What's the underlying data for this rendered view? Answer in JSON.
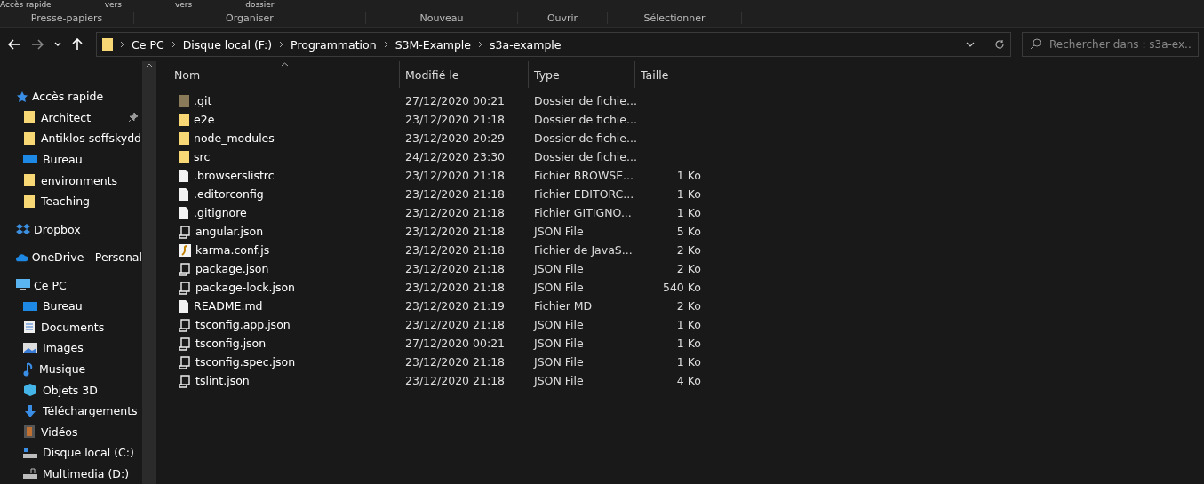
{
  "ribbon": {
    "cut_texts": [
      {
        "text": "Accès rapide"
      },
      {
        "text": "vers"
      },
      {
        "text": "vers"
      },
      {
        "text": "dossier"
      }
    ],
    "groups": [
      "Presse-papiers",
      "Organiser",
      "Nouveau",
      "Ouvrir",
      "Sélectionner"
    ]
  },
  "address_bar": {
    "path": [
      "Ce PC",
      "Disque local (F:)",
      "Programmation",
      "S3M-Example",
      "s3a-example"
    ]
  },
  "search": {
    "placeholder": "Rechercher dans : s3a-ex..."
  },
  "sidebar": {
    "sections": [
      {
        "label": "Accès rapide",
        "kind": "quick",
        "children": [
          {
            "label": "Architect",
            "kind": "folder",
            "pinned": true
          },
          {
            "label": "Antiklos soffskydd",
            "kind": "folder",
            "pinned": false
          },
          {
            "label": "Bureau",
            "kind": "desktop",
            "pinned": false
          },
          {
            "label": "environments",
            "kind": "folder",
            "pinned": false
          },
          {
            "label": "Teaching",
            "kind": "folder",
            "pinned": false
          }
        ]
      },
      {
        "label": "Dropbox",
        "kind": "dropbox"
      },
      {
        "label": "OneDrive - Personal",
        "kind": "onedrive"
      },
      {
        "label": "Ce PC",
        "kind": "pc",
        "children": [
          {
            "label": "Bureau",
            "kind": "desktop",
            "pinned": false
          },
          {
            "label": "Documents",
            "kind": "documents",
            "pinned": false
          },
          {
            "label": "Images",
            "kind": "images",
            "pinned": false
          },
          {
            "label": "Musique",
            "kind": "music",
            "pinned": false
          },
          {
            "label": "Objets 3D",
            "kind": "cube",
            "pinned": false
          },
          {
            "label": "Téléchargements",
            "kind": "download",
            "pinned": false
          },
          {
            "label": "Vidéos",
            "kind": "videos",
            "pinned": false
          },
          {
            "label": "Disque local (C:)",
            "kind": "drive",
            "pinned": false
          },
          {
            "label": "Multimedia (D:)",
            "kind": "netdrive",
            "pinned": false
          }
        ]
      }
    ]
  },
  "table": {
    "columns": [
      "Nom",
      "Modifié le",
      "Type",
      "Taille"
    ],
    "rows": [
      {
        "name": ".git",
        "kind": "git",
        "modified": "27/12/2020 00:21",
        "type": "Dossier de fichie..."
      },
      {
        "name": "e2e",
        "kind": "folder",
        "modified": "23/12/2020 21:18",
        "type": "Dossier de fichie..."
      },
      {
        "name": "node_modules",
        "kind": "folder",
        "modified": "23/12/2020 20:29",
        "type": "Dossier de fichie..."
      },
      {
        "name": "src",
        "kind": "folder",
        "modified": "24/12/2020 23:30",
        "type": "Dossier de fichie..."
      },
      {
        "name": ".browserslistrc",
        "kind": "file",
        "modified": "23/12/2020 21:18",
        "type": "Fichier BROWSE...",
        "size": "1 Ko"
      },
      {
        "name": ".editorconfig",
        "kind": "file",
        "modified": "23/12/2020 21:18",
        "type": "Fichier EDITORC...",
        "size": "1 Ko"
      },
      {
        "name": ".gitignore",
        "kind": "file",
        "modified": "23/12/2020 21:18",
        "type": "Fichier GITIGNO...",
        "size": "1 Ko"
      },
      {
        "name": "angular.json",
        "kind": "json",
        "modified": "23/12/2020 21:18",
        "type": "JSON File",
        "size": "5 Ko"
      },
      {
        "name": "karma.conf.js",
        "kind": "js",
        "modified": "23/12/2020 21:18",
        "type": "Fichier de JavaS...",
        "size": "2 Ko"
      },
      {
        "name": "package.json",
        "kind": "json",
        "modified": "23/12/2020 21:18",
        "type": "JSON File",
        "size": "2 Ko"
      },
      {
        "name": "package-lock.json",
        "kind": "json",
        "modified": "23/12/2020 21:18",
        "type": "JSON File",
        "size": "540 Ko"
      },
      {
        "name": "README.md",
        "kind": "file",
        "modified": "23/12/2020 21:19",
        "type": "Fichier MD",
        "size": "2 Ko"
      },
      {
        "name": "tsconfig.app.json",
        "kind": "json",
        "modified": "23/12/2020 21:18",
        "type": "JSON File",
        "size": "1 Ko"
      },
      {
        "name": "tsconfig.json",
        "kind": "json",
        "modified": "27/12/2020 00:21",
        "type": "JSON File",
        "size": "1 Ko"
      },
      {
        "name": "tsconfig.spec.json",
        "kind": "json",
        "modified": "23/12/2020 21:18",
        "type": "JSON File",
        "size": "1 Ko"
      },
      {
        "name": "tslint.json",
        "kind": "json",
        "modified": "23/12/2020 21:18",
        "type": "JSON File",
        "size": "4 Ko"
      }
    ]
  }
}
